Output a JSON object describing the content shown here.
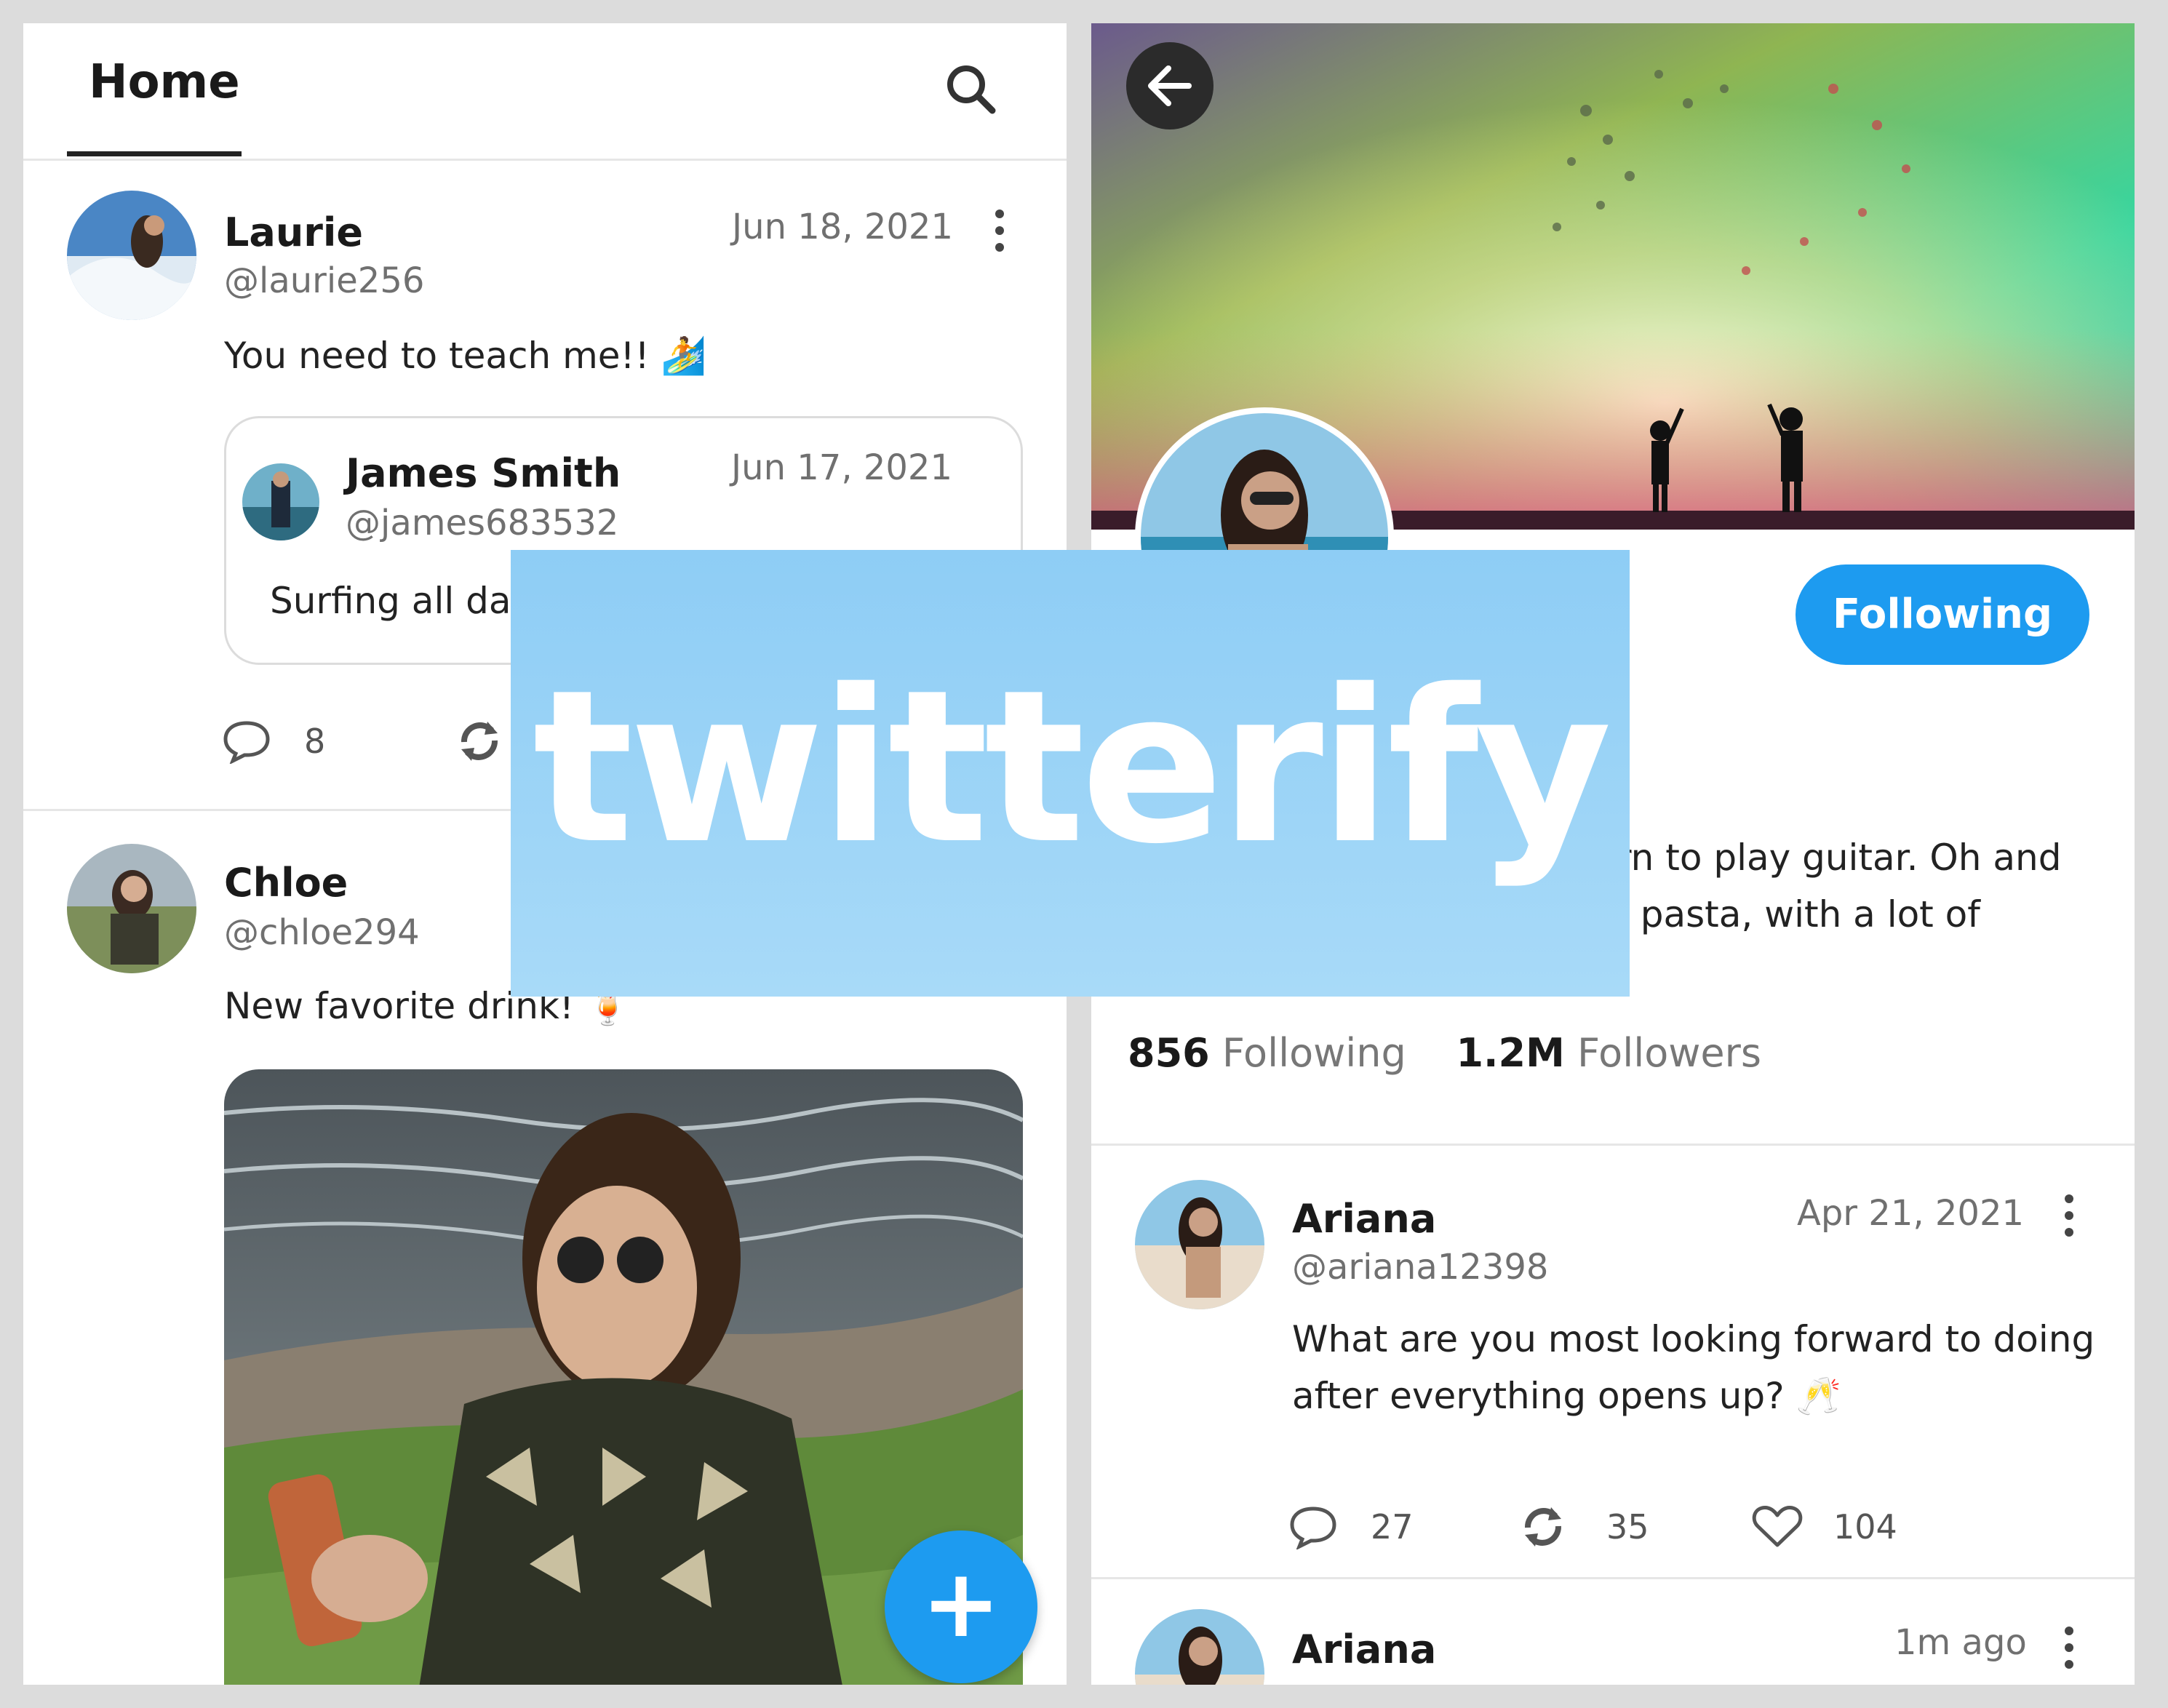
{
  "home": {
    "title": "Home",
    "posts": [
      {
        "name": "Laurie",
        "handle": "@laurie256",
        "date": "Jun 18, 2021",
        "text": "You need to teach me!! 🏄",
        "quote": {
          "name": "James Smith",
          "handle": "@james683532",
          "date": "Jun 17, 2021",
          "text": "Surfing all day"
        },
        "comments": "8"
      },
      {
        "name": "Chloe",
        "handle": "@chloe294",
        "text": "New favorite drink! 🍹"
      }
    ],
    "fab_label": "+"
  },
  "profile": {
    "follow_label": "Following",
    "bio_line1": "rn to play guitar. Oh and",
    "bio_line2": "/ pasta, with a lot of",
    "following_count": "856",
    "following_label": "Following",
    "followers_count": "1.2M",
    "followers_label": "Followers",
    "posts": [
      {
        "name": "Ariana",
        "handle": "@ariana12398",
        "date": "Apr 21, 2021",
        "text_line1": "What are you most looking forward to doing",
        "text_line2": "after everything opens up? 🥂",
        "comments": "27",
        "retweets": "35",
        "likes": "104"
      },
      {
        "name": "Ariana",
        "date": "1m ago"
      }
    ]
  },
  "logo": {
    "text": "twitterify"
  },
  "colors": {
    "accent": "#1d9bf0",
    "logo_bg": "#9dd5f7"
  }
}
